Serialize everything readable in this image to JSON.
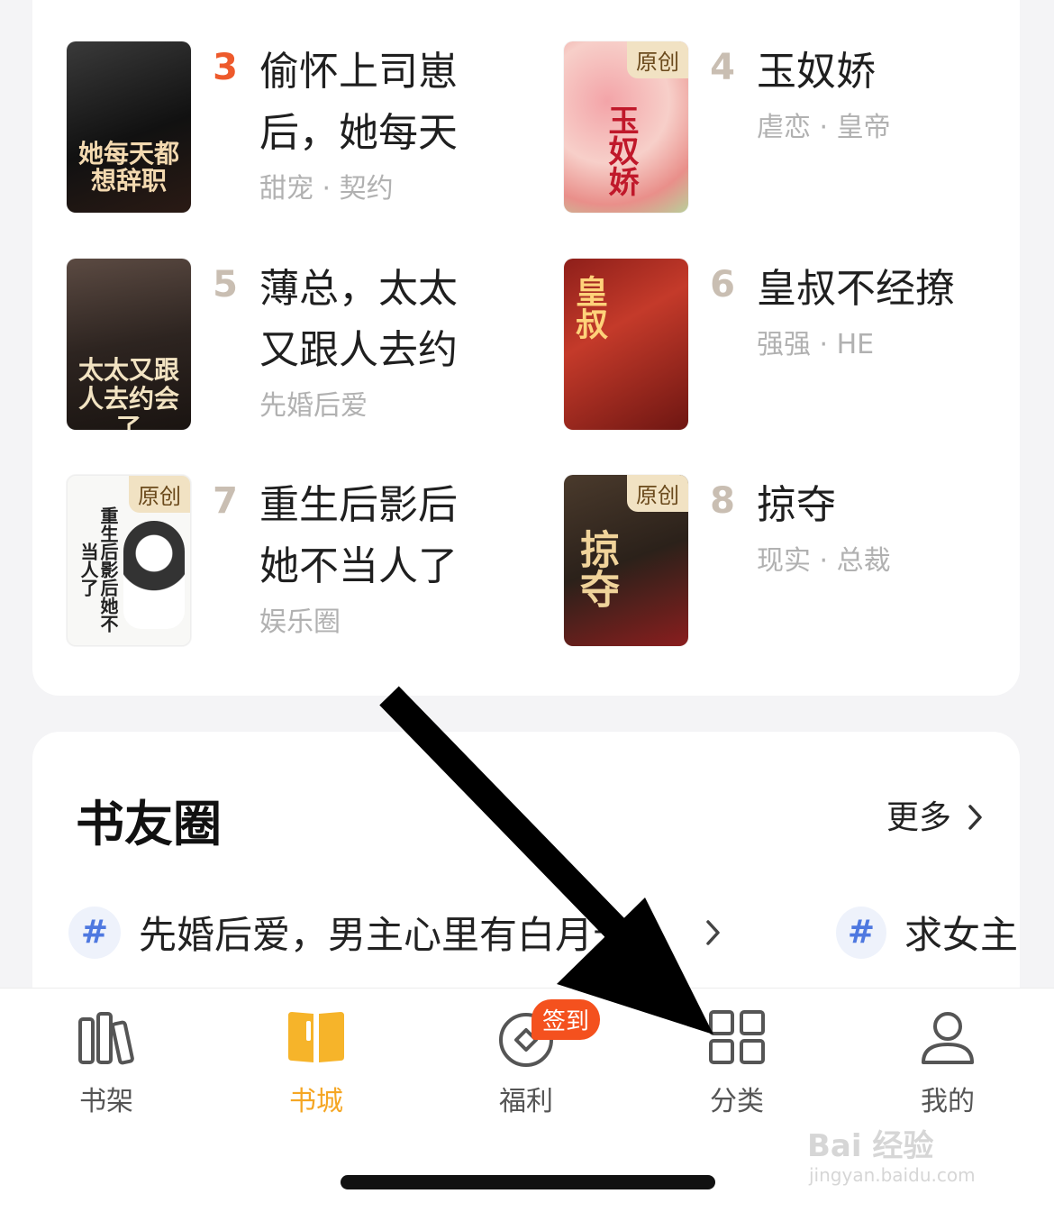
{
  "books": [
    {
      "rank": "3",
      "title": "偷怀上司崽后，她每天",
      "tags": "甜宠 · 契约",
      "cover_text": "她每天都想辞职",
      "badge": ""
    },
    {
      "rank": "4",
      "title": "玉奴娇",
      "tags": "虐恋 · 皇帝",
      "cover_text": "玉奴娇",
      "badge": "原创"
    },
    {
      "rank": "5",
      "title": "薄总，太太又跟人去约",
      "tags": "先婚后爱",
      "cover_text": "太太又跟人去约会了",
      "badge": ""
    },
    {
      "rank": "6",
      "title": "皇叔不经撩",
      "tags": "强强 · HE",
      "cover_text": "皇叔",
      "badge": ""
    },
    {
      "rank": "7",
      "title": "重生后影后她不当人了",
      "tags": "娱乐圈",
      "cover_text": "重生后影后她不当人了",
      "badge": "原创"
    },
    {
      "rank": "8",
      "title": "掠夺",
      "tags": "现实 · 总裁",
      "cover_text": "掠夺",
      "badge": "原创"
    }
  ],
  "circle": {
    "title": "书友圈",
    "more": "更多",
    "topics": [
      {
        "text": "先婚后爱，男主心里有白月光..."
      },
      {
        "text": "求女主"
      }
    ]
  },
  "tabbar": {
    "items": [
      {
        "label": "书架",
        "icon": "bookshelf-icon"
      },
      {
        "label": "书城",
        "icon": "open-book-icon"
      },
      {
        "label": "福利",
        "icon": "coin-icon"
      },
      {
        "label": "分类",
        "icon": "grid-icon"
      },
      {
        "label": "我的",
        "icon": "person-icon"
      }
    ],
    "signin_badge": "签到",
    "active": "书城"
  },
  "watermark": {
    "main": "Bai 经验",
    "sub": "jingyan.baidu.com"
  },
  "colors": {
    "accent": "#f5a623",
    "rank_top": "#ee5a2c",
    "badge": "#f4511e"
  }
}
